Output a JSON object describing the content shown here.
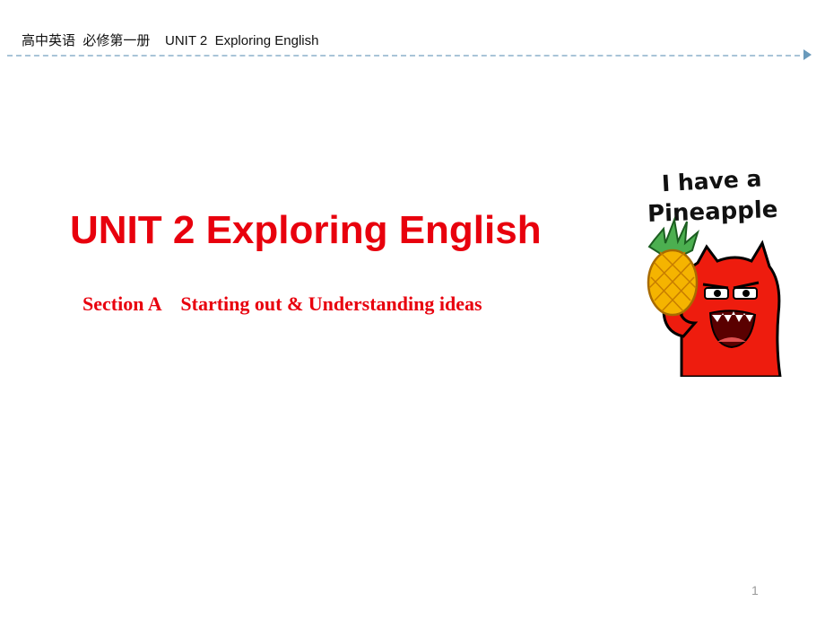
{
  "header": {
    "text": "高中英语  必修第一册    UNIT 2  Exploring English"
  },
  "slide": {
    "title": "UNIT 2 Exploring English",
    "subtitle": "Section A    Starting out & Understanding ideas"
  },
  "illustration": {
    "caption_line1": "I have a",
    "caption_line2": "Pineapple",
    "character_color": "#ee1c0e",
    "pineapple_color": "#f5b400",
    "leaf_color": "#4caf50"
  },
  "footer": {
    "page_number": "1"
  }
}
